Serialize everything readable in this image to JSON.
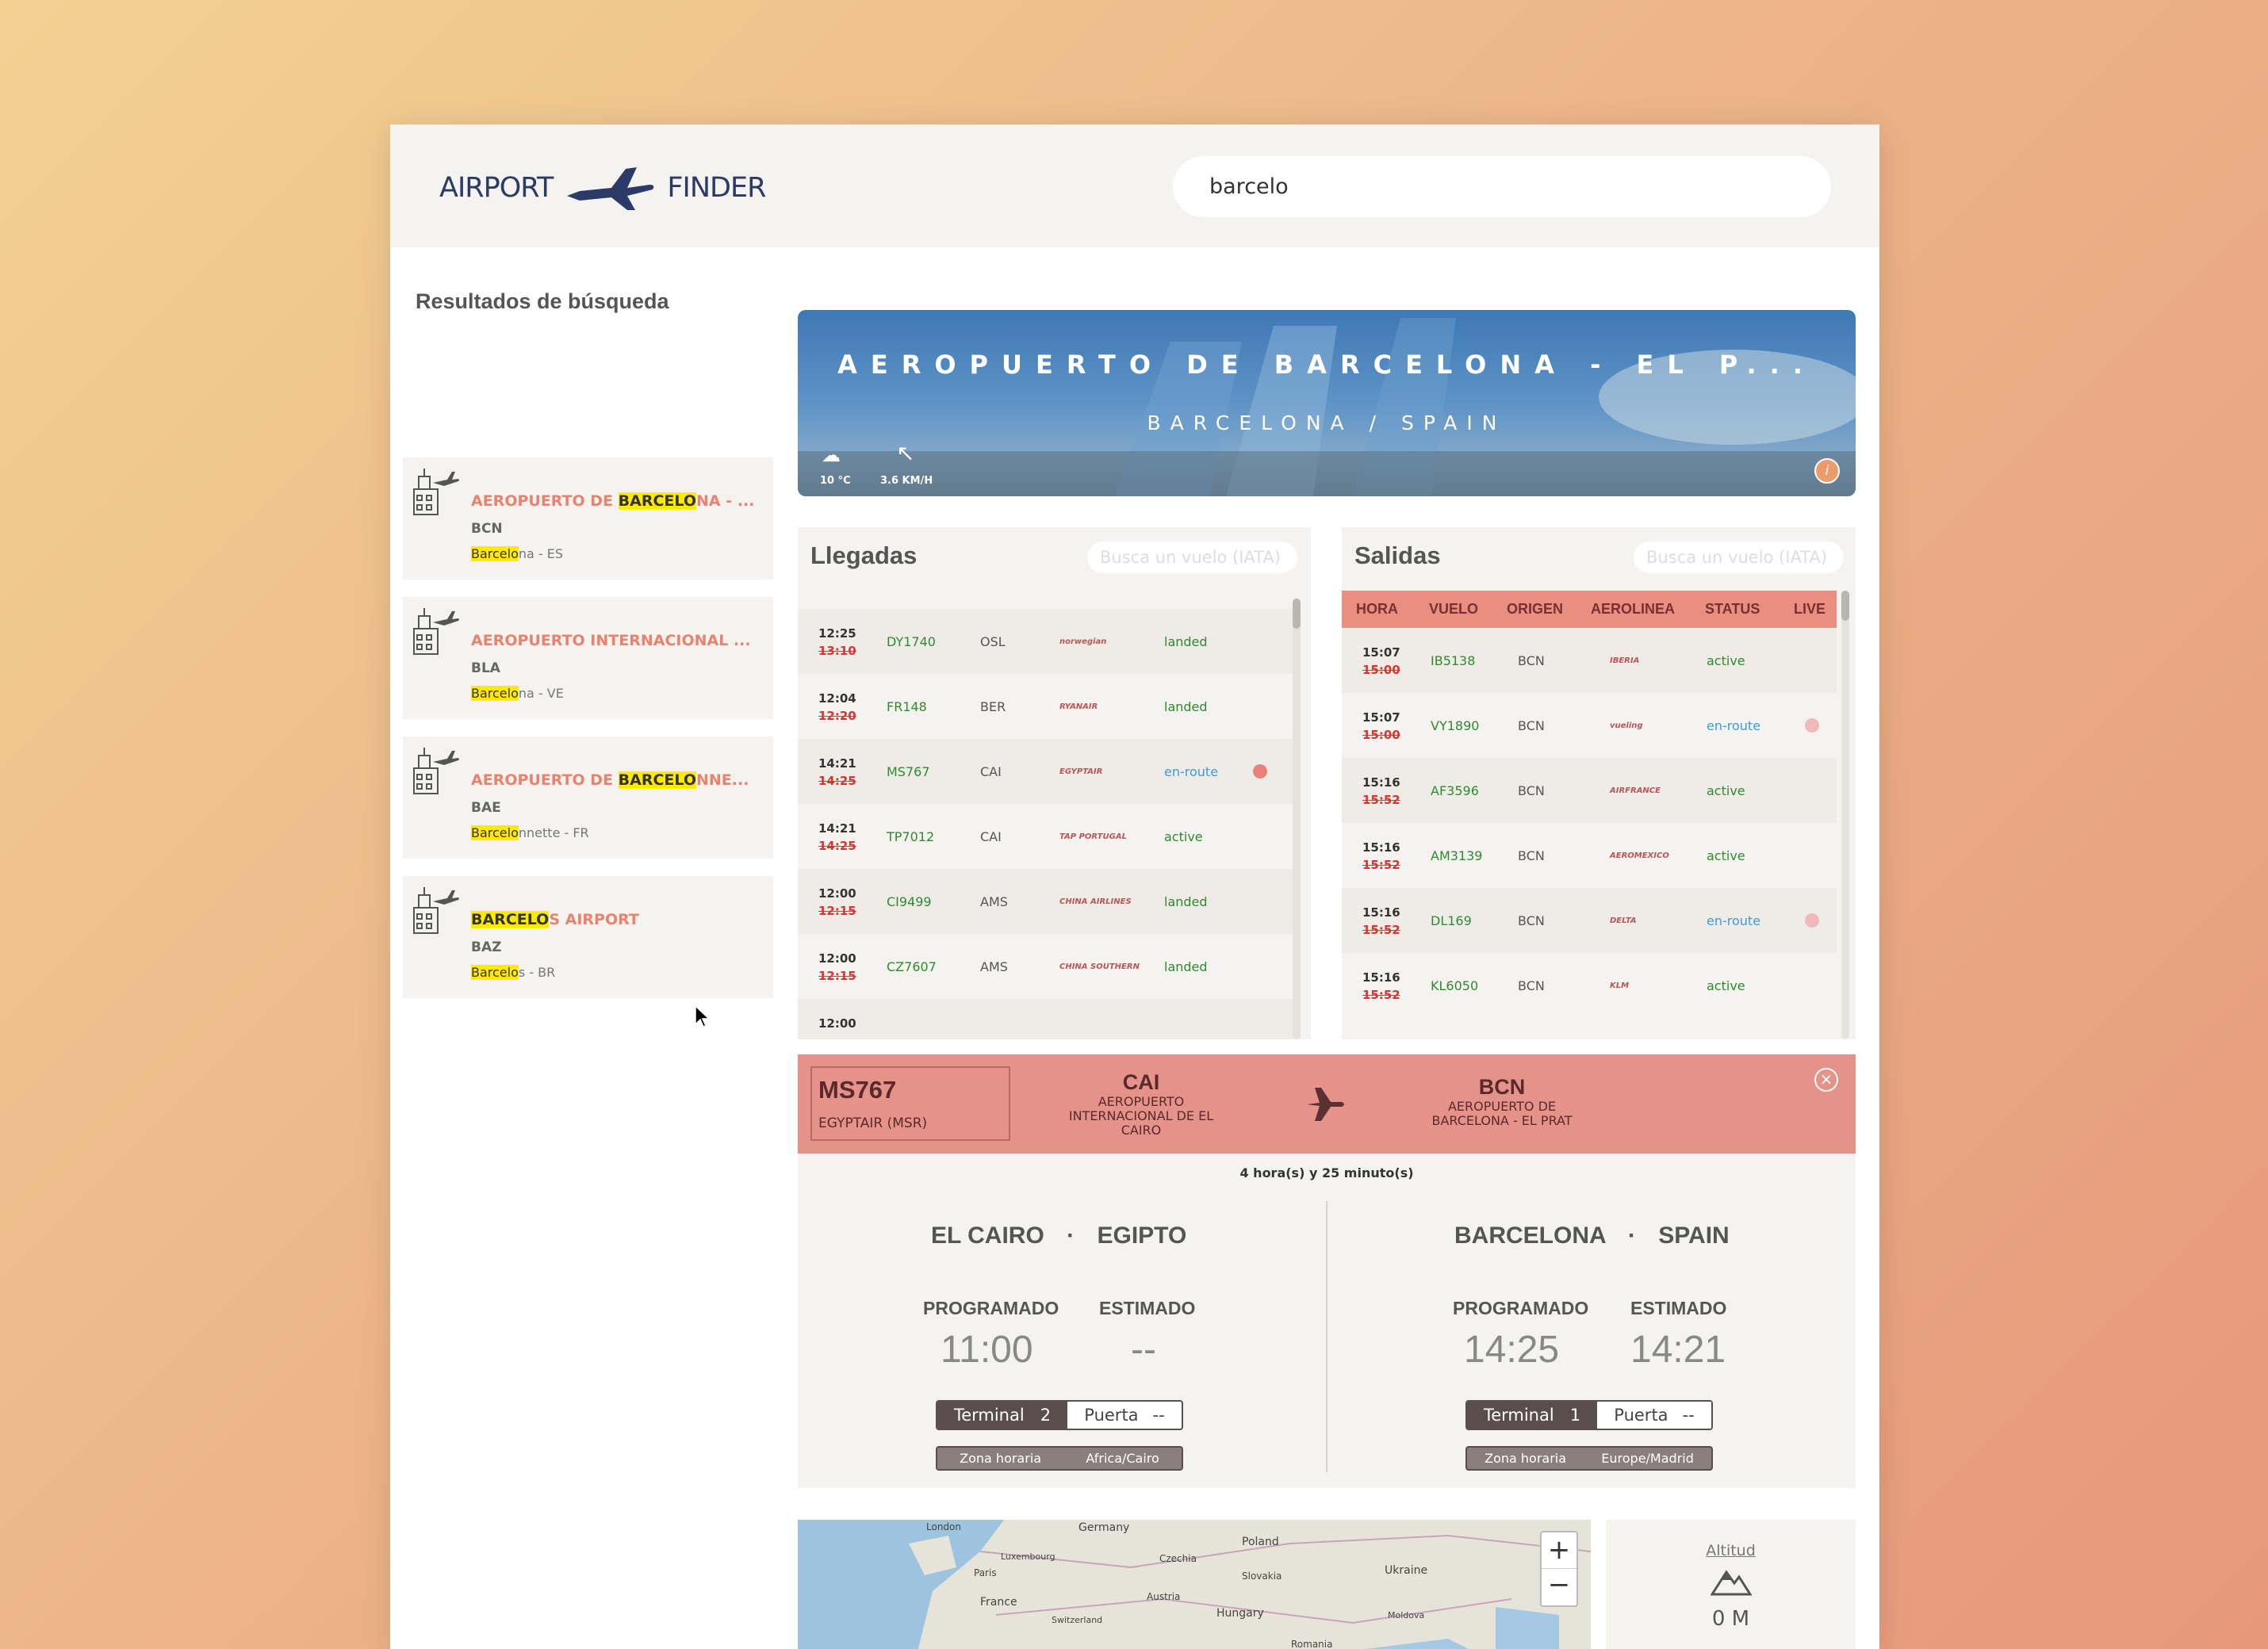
{
  "brand": {
    "left": "AIRPORT",
    "right": "FINDER"
  },
  "search": {
    "value": "barcelo"
  },
  "sidebar": {
    "title": "Resultados de búsqueda",
    "results": [
      {
        "pre": "AEROPUERTO DE ",
        "hl": "BARCELO",
        "post": "NA - ...",
        "code": "BCN",
        "city_hl": "Barcelo",
        "city_rest": "na - ES"
      },
      {
        "pre": "AEROPUERTO INTERNACIONAL ...",
        "hl": "",
        "post": "",
        "code": "BLA",
        "city_hl": "Barcelo",
        "city_rest": "na - VE"
      },
      {
        "pre": "AEROPUERTO DE ",
        "hl": "BARCELO",
        "post": "NNE...",
        "code": "BAE",
        "city_hl": "Barcelo",
        "city_rest": "nnette - FR"
      },
      {
        "pre": "",
        "hl": "BARCELO",
        "post": "S AIRPORT",
        "code": "BAZ",
        "city_hl": "Barcelo",
        "city_rest": "s - BR"
      }
    ]
  },
  "banner": {
    "title": "AEROPUERTO DE BARCELONA - EL P...",
    "subtitle": "BARCELONA / SPAIN",
    "temp": "10 °C",
    "wind": "3.6 KM/H",
    "info": "i"
  },
  "arrivals": {
    "title": "Llegadas",
    "placeholder": "Busca un vuelo (IATA)",
    "rows": [
      {
        "sched": "12:25",
        "old": "13:10",
        "flight": "DY1740",
        "origin": "OSL",
        "airline": "norwegian",
        "status": "landed",
        "live": ""
      },
      {
        "sched": "12:04",
        "old": "12:20",
        "flight": "FR148",
        "origin": "BER",
        "airline": "RYANAIR",
        "status": "landed",
        "live": ""
      },
      {
        "sched": "14:21",
        "old": "14:25",
        "flight": "MS767",
        "origin": "CAI",
        "airline": "EGYPTAIR",
        "status": "en-route",
        "live": "#e8837a"
      },
      {
        "sched": "14:21",
        "old": "14:25",
        "flight": "TP7012",
        "origin": "CAI",
        "airline": "TAP PORTUGAL",
        "status": "active",
        "live": ""
      },
      {
        "sched": "12:00",
        "old": "12:15",
        "flight": "CI9499",
        "origin": "AMS",
        "airline": "CHINA AIRLINES",
        "status": "landed",
        "live": ""
      },
      {
        "sched": "12:00",
        "old": "12:15",
        "flight": "CZ7607",
        "origin": "AMS",
        "airline": "CHINA SOUTHERN",
        "status": "landed",
        "live": ""
      },
      {
        "sched": "12:00",
        "old": "",
        "flight": "",
        "origin": "",
        "airline": "",
        "status": "",
        "live": ""
      }
    ]
  },
  "departures": {
    "title": "Salidas",
    "placeholder": "Busca un vuelo (IATA)",
    "headers": [
      "HORA",
      "VUELO",
      "ORIGEN",
      "AEROLINEA",
      "STATUS",
      "LIVE"
    ],
    "rows": [
      {
        "sched": "15:07",
        "old": "15:00",
        "flight": "IB5138",
        "origin": "BCN",
        "airline": "IBERIA",
        "status": "active",
        "live": ""
      },
      {
        "sched": "15:07",
        "old": "15:00",
        "flight": "VY1890",
        "origin": "BCN",
        "airline": "vueling",
        "status": "en-route",
        "live": "#f0b8b8"
      },
      {
        "sched": "15:16",
        "old": "15:52",
        "flight": "AF3596",
        "origin": "BCN",
        "airline": "AIRFRANCE",
        "status": "active",
        "live": ""
      },
      {
        "sched": "15:16",
        "old": "15:52",
        "flight": "AM3139",
        "origin": "BCN",
        "airline": "AEROMEXICO",
        "status": "active",
        "live": ""
      },
      {
        "sched": "15:16",
        "old": "15:52",
        "flight": "DL169",
        "origin": "BCN",
        "airline": "DELTA",
        "status": "en-route",
        "live": "#f0b8b8"
      },
      {
        "sched": "15:16",
        "old": "15:52",
        "flight": "KL6050",
        "origin": "BCN",
        "airline": "KLM",
        "status": "active",
        "live": ""
      }
    ]
  },
  "detail": {
    "code": "MS767",
    "airline": "EGYPTAIR (MSR)",
    "from": {
      "iata": "CAI",
      "name": "AEROPUERTO INTERNACIONAL DE EL CAIRO"
    },
    "to": {
      "iata": "BCN",
      "name": "AEROPUERTO DE BARCELONA - EL PRAT"
    },
    "duration": "4 hora(s) y 25 minuto(s)",
    "labels": {
      "scheduled": "PROGRAMADO",
      "estimated": "ESTIMADO",
      "terminal": "Terminal",
      "gate": "Puerta",
      "tz": "Zona horaria"
    },
    "origin": {
      "city": "EL CAIRO",
      "country": "EGIPTO",
      "scheduled": "11:00",
      "estimated": "--",
      "terminal": "2",
      "gate": "--",
      "tz": "Africa/Cairo"
    },
    "dest": {
      "city": "BARCELONA",
      "country": "SPAIN",
      "scheduled": "14:25",
      "estimated": "14:21",
      "terminal": "1",
      "gate": "--",
      "tz": "Europe/Madrid"
    }
  },
  "map": {
    "labels": [
      "London",
      "Germany",
      "Poland",
      "Luxembourg",
      "Czechia",
      "Ukraine",
      "Paris",
      "Slovakia",
      "Austria",
      "France",
      "Switzerland",
      "Hungary",
      "Moldova",
      "Romania"
    ],
    "zoom_in": "+",
    "zoom_out": "−"
  },
  "altitude": {
    "label": "Altitud",
    "value": "0 M"
  }
}
